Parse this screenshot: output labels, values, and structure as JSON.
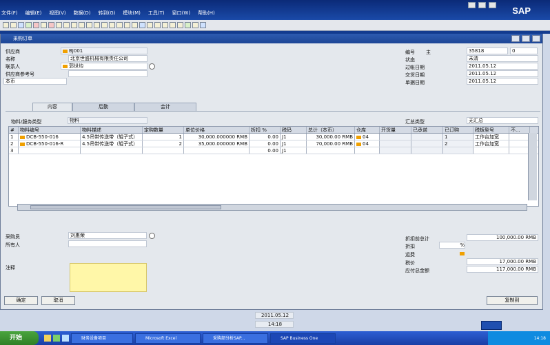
{
  "menubar": {
    "items": [
      "文件(F)",
      "编辑(E)",
      "视图(V)",
      "数据(D)",
      "转到(G)",
      "模块(M)",
      "工具(T)",
      "窗口(W)",
      "帮助(H)"
    ],
    "brand": "SAP"
  },
  "window": {
    "title": "采购订单"
  },
  "vendor": {
    "label_code": "供应商",
    "code": "BJ001",
    "label_name": "名称",
    "name": "北京世盛机械有限责任公司",
    "label_contact": "联系人",
    "contact": "郭世均",
    "label_ref": "供应商参考号",
    "ref": "",
    "currency": "本币"
  },
  "doc": {
    "label_no": "编号",
    "series": "主",
    "no": "35818",
    "sub": "0",
    "label_status": "状态",
    "status": "未清",
    "label_posting": "过帐日期",
    "posting": "2011.05.12",
    "label_delivery": "交货日期",
    "delivery": "2011.05.12",
    "label_docdate": "单据日期",
    "docdate": "2011.05.12"
  },
  "tabs": [
    "内容",
    "后勤",
    "会计"
  ],
  "item_type": {
    "label": "物料/服务类型",
    "value": "物料"
  },
  "summary_type": {
    "label": "汇总类型",
    "value": "无汇总"
  },
  "table": {
    "columns": [
      "#",
      "物料编号",
      "物料描述",
      "定购数量",
      "单位价格",
      "折扣 %",
      "税码",
      "总计（本币）",
      "仓库",
      "开货量",
      "已承诺",
      "已订购",
      "税板型号",
      "不..."
    ],
    "rows": [
      [
        "1",
        "DCB-550-016",
        "4.5吊带传送带（辊子式）",
        "1",
        "30,000.000000 RMB",
        "0.00",
        "J1",
        "30,000.00 RMB",
        "04",
        "",
        "",
        "1",
        "工作台加宽",
        ""
      ],
      [
        "2",
        "DCB-550-016-R",
        "4.5吊带传送带（辊子式）",
        "2",
        "35,000.000000 RMB",
        "0.00",
        "J1",
        "70,000.00 RMB",
        "04",
        "",
        "",
        "2",
        "工作台加宽",
        ""
      ],
      [
        "3",
        "",
        "",
        "",
        "",
        "0.00",
        "J1",
        "",
        "",
        "",
        "",
        "",
        "",
        ""
      ]
    ]
  },
  "bottom": {
    "label_buyer": "采购员",
    "buyer": "刘惠荣",
    "label_owner": "所有人",
    "owner": "",
    "label_remark": "注释"
  },
  "totals": {
    "label_before": "折扣前总计",
    "before": "100,000.00 RMB",
    "label_discount": "折扣",
    "discount_pct": "%",
    "label_freight": "运费",
    "label_tax": "税价",
    "tax": "17,000.00 RMB",
    "label_total": "应付总金额",
    "total": "117,000.00 RMB"
  },
  "buttons": {
    "ok": "确定",
    "cancel": "取消",
    "copy_to": "复制到"
  },
  "status": {
    "date": "2011.05.12",
    "time": "14:18"
  },
  "taskbar": {
    "start": "开始",
    "tasks": [
      "财务设备项目",
      "Microsoft Excel",
      "采购部分析SAP...",
      "SAP Business One"
    ],
    "clock": "14:18"
  }
}
